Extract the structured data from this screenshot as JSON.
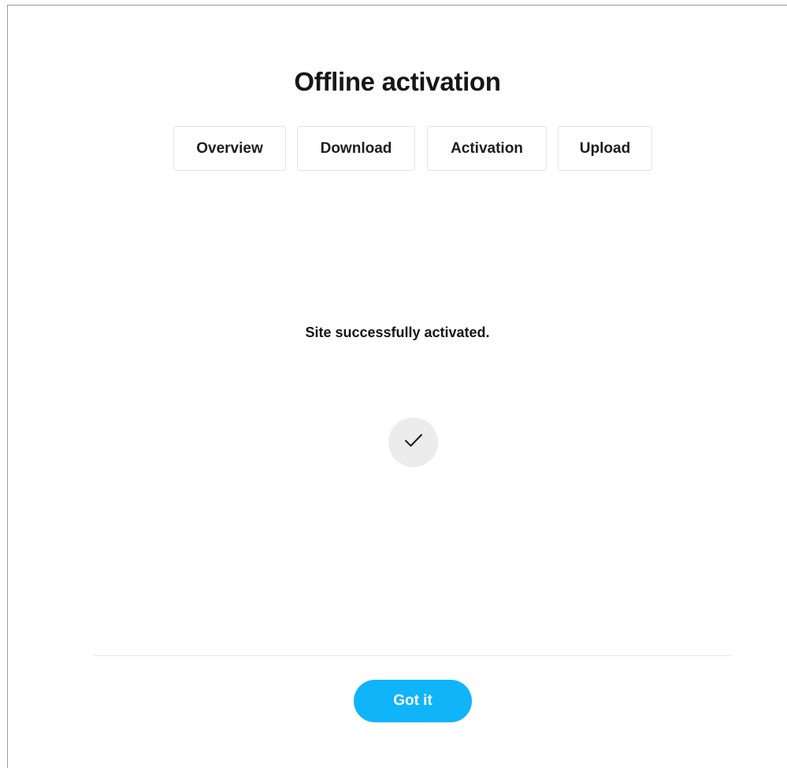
{
  "dialog": {
    "title": "Offline activation",
    "tabs": [
      {
        "label": "Overview"
      },
      {
        "label": "Download"
      },
      {
        "label": "Activation"
      },
      {
        "label": "Upload"
      }
    ],
    "message": "Site successfully activated.",
    "status_icon": "checkmark-icon",
    "confirm_label": "Got it"
  },
  "colors": {
    "accent": "#10b4f9",
    "icon_bg": "#ececec",
    "text": "#161616"
  }
}
